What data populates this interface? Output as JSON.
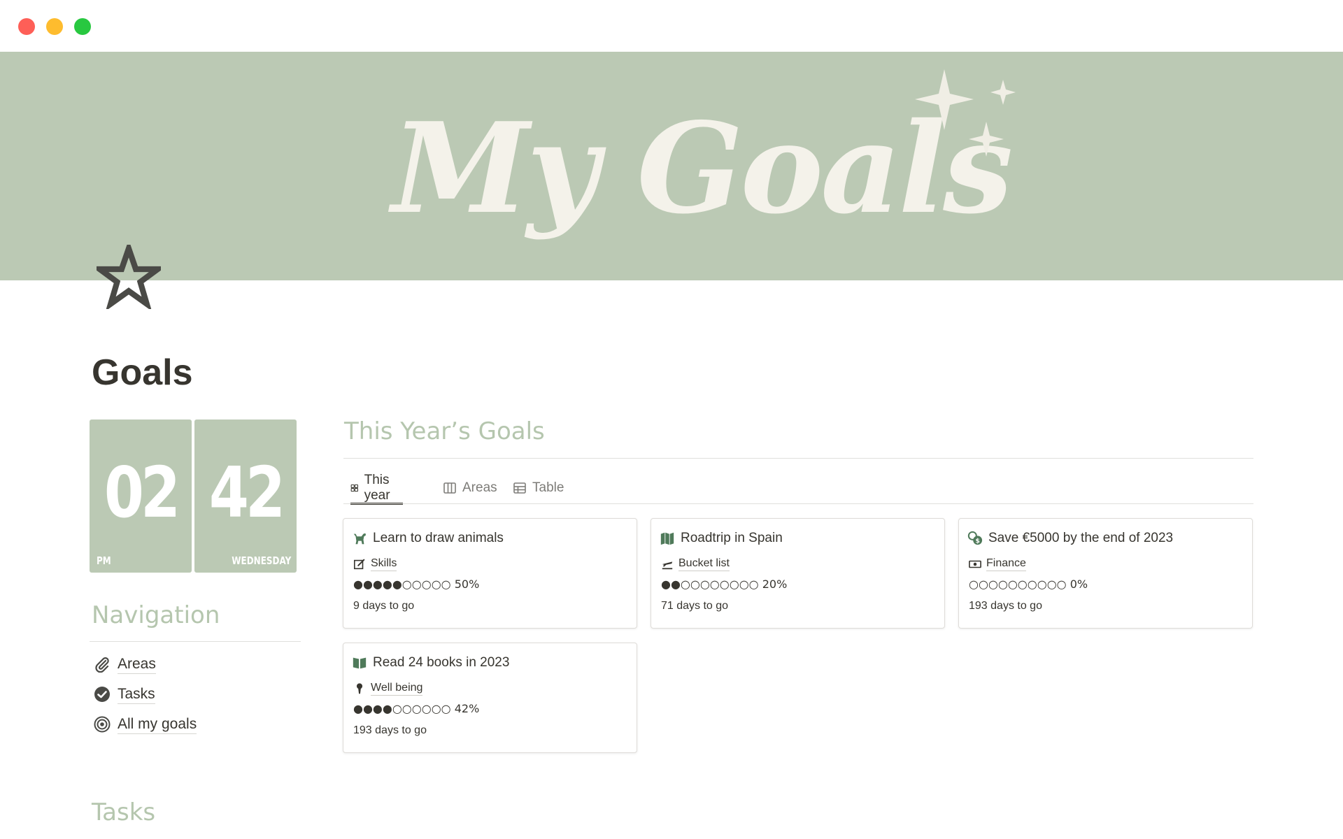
{
  "window": {
    "controls": [
      "close",
      "minimize",
      "zoom"
    ]
  },
  "cover": {
    "title": "My Goals",
    "background_color": "#bbc9b4",
    "decoration": "sparkles-icon"
  },
  "page": {
    "icon": "star-icon",
    "title": "Goals"
  },
  "clock": {
    "hour": "02",
    "minute": "42",
    "period": "PM",
    "weekday": "WEDNESDAY"
  },
  "navigation": {
    "heading": "Navigation",
    "items": [
      {
        "label": "Areas",
        "icon": "paperclip-icon"
      },
      {
        "label": "Tasks",
        "icon": "checkmark-circle-icon"
      },
      {
        "label": "All my goals",
        "icon": "target-icon"
      }
    ]
  },
  "goals_section": {
    "heading": "This Year’s Goals",
    "tabs": [
      {
        "label": "This year",
        "icon": "gallery-icon",
        "active": true
      },
      {
        "label": "Areas",
        "icon": "board-icon",
        "active": false
      },
      {
        "label": "Table",
        "icon": "table-icon",
        "active": false
      }
    ],
    "cards": [
      {
        "title": "Learn to draw animals",
        "icon": "dog-icon",
        "area": "Skills",
        "area_icon": "edit-icon",
        "progress_bar": "●●●●●○○○○○",
        "progress": "50%",
        "days": "9 days to go"
      },
      {
        "title": "Roadtrip in Spain",
        "icon": "map-icon",
        "area": "Bucket list",
        "area_icon": "plane-icon",
        "progress_bar": "●●○○○○○○○○",
        "progress": "20%",
        "days": "71 days to go"
      },
      {
        "title": "Save €5000 by the end of 2023",
        "icon": "coins-icon",
        "area": "Finance",
        "area_icon": "money-icon",
        "progress_bar": "○○○○○○○○○○",
        "progress": "0%",
        "days": "193 days to go"
      },
      {
        "title": "Read 24 books in 2023",
        "icon": "book-icon",
        "area": "Well being",
        "area_icon": "person-icon",
        "progress_bar": "●●●●○○○○○○",
        "progress": "42%",
        "days": "193 days to go"
      }
    ]
  },
  "tasks_section": {
    "heading": "Tasks"
  },
  "colors": {
    "accent_sage": "#bbc9b4",
    "heading_sage": "#b5c6ae",
    "icon_green": "#4f7a5a",
    "text": "#37352f"
  }
}
